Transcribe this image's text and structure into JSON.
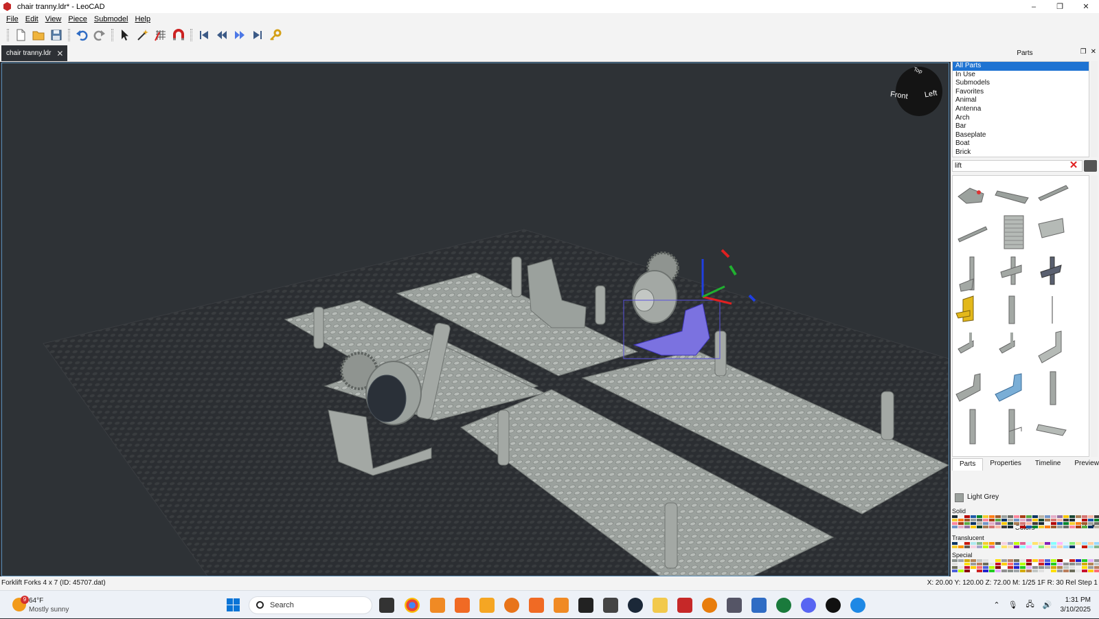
{
  "window": {
    "title": "chair tranny.ldr* - LeoCAD",
    "minimize": "–",
    "maximize": "❐",
    "close": "✕"
  },
  "menu": {
    "items": [
      {
        "label": "File"
      },
      {
        "label": "Edit"
      },
      {
        "label": "View"
      },
      {
        "label": "Piece"
      },
      {
        "label": "Submodel"
      },
      {
        "label": "Help"
      }
    ]
  },
  "toolbar": {
    "icons": [
      "new-file-icon",
      "open-folder-icon",
      "save-icon",
      "undo-icon",
      "redo-icon",
      "select-arrow-icon",
      "magic-wand-icon",
      "snap-grid-icon",
      "magnet-icon",
      "first-step-icon",
      "previous-step-icon",
      "next-step-icon",
      "last-step-icon",
      "key-icon"
    ]
  },
  "document": {
    "tab_label": "chair tranny.ldr",
    "tab_close": "✕"
  },
  "viewcube": {
    "front": "Front",
    "left": "Left",
    "top": "Top"
  },
  "parts_panel": {
    "title": "Parts",
    "categories": [
      "All Parts",
      "In Use",
      "Submodels",
      "Favorites",
      "Animal",
      "Antenna",
      "Arch",
      "Bar",
      "Baseplate",
      "Boat",
      "Brick"
    ],
    "selected_category": "All Parts",
    "search_value": "lift",
    "tabs": [
      "Parts",
      "Properties",
      "Timeline",
      "Preview"
    ],
    "selected_tab": "Parts"
  },
  "colors_panel": {
    "title": "Colors",
    "current_color": "Light Grey",
    "current_color_hex": "#9ba19d",
    "sections": [
      "Solid",
      "Translucent",
      "Special"
    ]
  },
  "status": {
    "left": "Forklift Forks 4 x 7 (ID: 45707.dat)",
    "right": "X: 20.00 Y: 120.00 Z: 72.00   M: 1/25 1F R: 30 Rel   Step 1"
  },
  "taskbar": {
    "weather_temp": "64°F",
    "weather_cond": "Mostly sunny",
    "weather_badge": "9",
    "search_label": "Search",
    "time": "1:31 PM",
    "date": "3/10/2025"
  },
  "colors": {
    "accent": "#1e73d2",
    "viewport_bg": "#2e3236",
    "plate_grey": "#9ba19d",
    "selection": "#7b72e0"
  }
}
